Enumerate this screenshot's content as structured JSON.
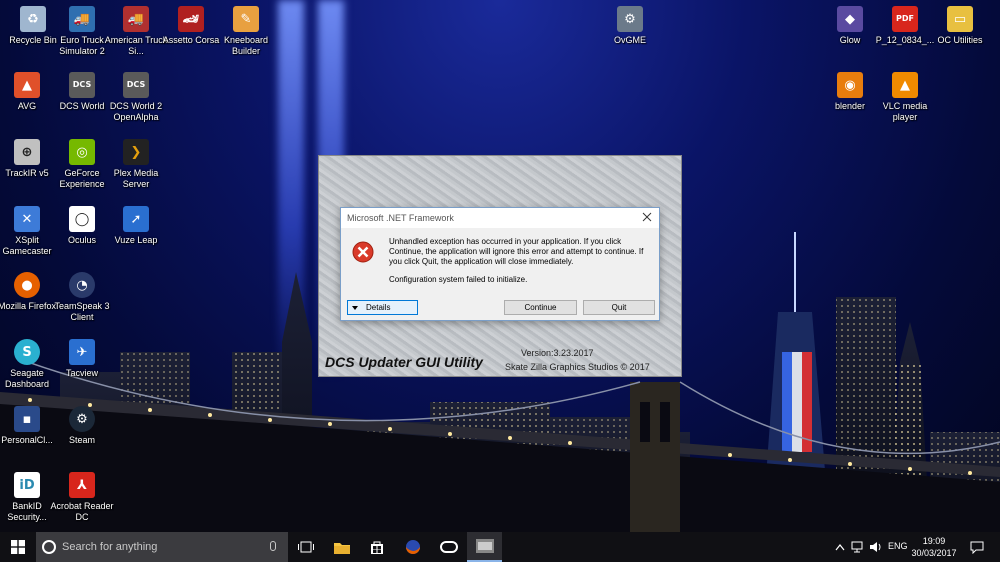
{
  "desktop": {
    "icons": [
      {
        "label": "Recycle Bin",
        "icon": "recycle-bin-icon",
        "color": "#9fb6cf"
      },
      {
        "label": "Euro Truck Simulator 2",
        "icon": "truck-icon",
        "color": "#2f6fb0"
      },
      {
        "label": "American Truck Si...",
        "icon": "truck-icon",
        "color": "#b03030"
      },
      {
        "label": "Assetto Corsa",
        "icon": "car-icon",
        "color": "#b02020"
      },
      {
        "label": "Kneeboard Builder",
        "icon": "notepad-icon",
        "color": "#e8a040"
      },
      {
        "label": "OvGME",
        "icon": "gear-icon",
        "color": "#6b7a8a"
      },
      {
        "label": "Glow",
        "icon": "app-icon",
        "color": "#5a4aa0"
      },
      {
        "label": "P_12_0834_...",
        "icon": "pdf-icon",
        "color": "#d8261c"
      },
      {
        "label": "OC Utilities",
        "icon": "folder-icon",
        "color": "#e8c040"
      },
      {
        "label": "AVG",
        "icon": "antivirus-icon",
        "color": "#e0502a"
      },
      {
        "label": "DCS World",
        "icon": "dcs-icon",
        "color": "#5a5a5a"
      },
      {
        "label": "DCS World 2 OpenAlpha",
        "icon": "dcs-icon",
        "color": "#5a5a5a"
      },
      {
        "label": "blender",
        "icon": "blender-icon",
        "color": "#e87d0d"
      },
      {
        "label": "VLC media player",
        "icon": "vlc-cone-icon",
        "color": "#f08a00"
      },
      {
        "label": "TrackIR v5",
        "icon": "trackir-icon",
        "color": "#c0c0c0"
      },
      {
        "label": "GeForce Experience",
        "icon": "geforce-icon",
        "color": "#76b900"
      },
      {
        "label": "Plex Media Server",
        "icon": "plex-icon",
        "color": "#e5a00d"
      },
      {
        "label": "XSplit Gamecaster",
        "icon": "xsplit-icon",
        "color": "#3d7bd8"
      },
      {
        "label": "Oculus",
        "icon": "oculus-icon",
        "color": "#222222"
      },
      {
        "label": "Vuze Leap",
        "icon": "vuze-icon",
        "color": "#2a6fd0"
      },
      {
        "label": "Mozilla Firefox",
        "icon": "firefox-icon",
        "color": "#e66000"
      },
      {
        "label": "TeamSpeak 3 Client",
        "icon": "teamspeak-icon",
        "color": "#2a3a6a"
      },
      {
        "label": "Seagate Dashboard",
        "icon": "seagate-icon",
        "color": "#2ab0d0"
      },
      {
        "label": "Tacview",
        "icon": "tacview-icon",
        "color": "#2a6fd0"
      },
      {
        "label": "PersonalCl...",
        "icon": "app-icon",
        "color": "#2a4a8a"
      },
      {
        "label": "Steam",
        "icon": "steam-icon",
        "color": "#1b2838"
      },
      {
        "label": "BankID Security...",
        "icon": "bankid-icon",
        "color": "#2a8ab0"
      },
      {
        "label": "Acrobat Reader DC",
        "icon": "pdf-icon",
        "color": "#d8261c"
      }
    ]
  },
  "updater": {
    "title": "DCS Updater GUI Utility",
    "version": "Version:3.23.2017",
    "studio": "Skate Zilla Graphics Studios © 2017"
  },
  "dialog": {
    "title": "Microsoft .NET Framework",
    "message": "Unhandled exception has occurred in your application. If you click Continue, the application will ignore this error and attempt to continue. If you click Quit, the application will close immediately.",
    "detail": "Configuration system failed to initialize.",
    "details_label": "Details",
    "continue_label": "Continue",
    "quit_label": "Quit"
  },
  "taskbar": {
    "search_placeholder": "Search for anything",
    "language": "ENG",
    "time": "19:09",
    "date": "30/03/2017",
    "accent": "#8ab4e8"
  }
}
